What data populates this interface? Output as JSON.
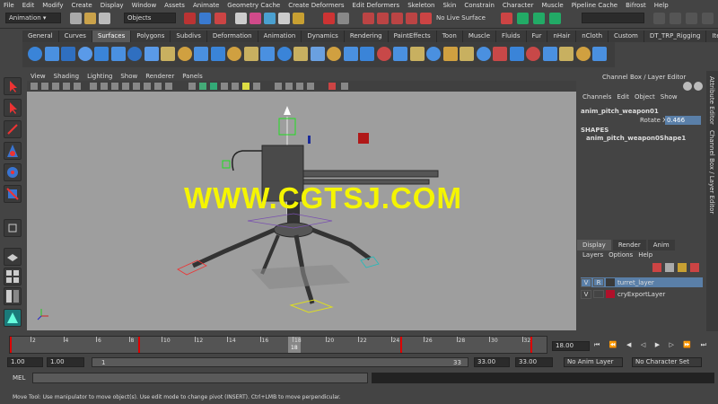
{
  "menu": [
    "File",
    "Edit",
    "Modify",
    "Create",
    "Display",
    "Window",
    "Assets",
    "Animate",
    "Geometry Cache",
    "Create Deformers",
    "Edit Deformers",
    "Skeleton",
    "Skin",
    "Constrain",
    "Character",
    "Muscle",
    "Pipeline Cache",
    "Bifrost",
    "Help"
  ],
  "status": {
    "mode": "Animation",
    "objects_label": "Objects",
    "live_surface": "No Live Surface"
  },
  "shelf_tabs": [
    "General",
    "Curves",
    "Surfaces",
    "Polygons",
    "Subdivs",
    "Deformation",
    "Animation",
    "Dynamics",
    "Rendering",
    "PaintEffects",
    "Toon",
    "Muscle",
    "Fluids",
    "Fur",
    "nHair",
    "nCloth",
    "Custom",
    "DT_TRP_Rigging",
    "Item"
  ],
  "shelf_active": "Surfaces",
  "viewport_menu": [
    "View",
    "Shading",
    "Lighting",
    "Show",
    "Renderer",
    "Panels"
  ],
  "watermark": "WWW.CGTSJ.COM",
  "channel_box": {
    "header": "Channel Box / Layer Editor",
    "menu": [
      "Channels",
      "Edit",
      "Object",
      "Show"
    ],
    "object": "anim_pitch_weapon01",
    "attr_label": "Rotate X",
    "attr_value": "0.466",
    "shapes_label": "SHAPES",
    "shape": "anim_pitch_weapon0Shape1"
  },
  "side_tabs": [
    "Attribute Editor",
    "Channel Box / Layer Editor"
  ],
  "layer_editor": {
    "tabs": [
      "Display",
      "Render",
      "Anim"
    ],
    "menu": [
      "Layers",
      "Options",
      "Help"
    ],
    "layers": [
      {
        "v": "V",
        "r": "R",
        "name": "turret_layer",
        "color": "#3a3a3a",
        "selected": true
      },
      {
        "v": "V",
        "r": "",
        "name": "cryExportLayer",
        "color": "#b0102a",
        "selected": false
      }
    ]
  },
  "timeline": {
    "ticks": [
      "2",
      "4",
      "6",
      "8",
      "10",
      "12",
      "14",
      "16",
      "18",
      "20",
      "22",
      "24",
      "26",
      "28",
      "30",
      "32"
    ],
    "current_frame": "18",
    "current_field": "18.00"
  },
  "range": {
    "start": "1.00",
    "start2": "1.00",
    "slider_left": "1",
    "slider_right": "33",
    "end": "33.00",
    "end2": "33.00",
    "anim_layer": "No Anim Layer",
    "character": "No Character Set"
  },
  "cmd": {
    "label": "MEL"
  },
  "help_line": "Move Tool: Use manipulator to move object(s). Use edit mode to change pivot (INSERT). Ctrl+LMB to move perpendicular."
}
